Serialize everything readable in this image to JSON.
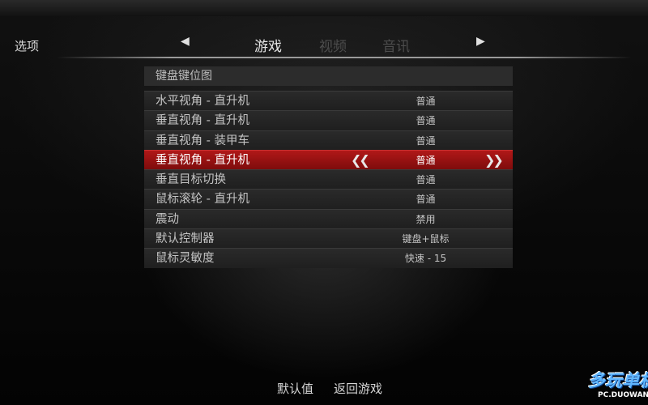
{
  "header": {
    "options_label": "选项",
    "tabs": [
      {
        "label": "游戏",
        "active": true
      },
      {
        "label": "视频",
        "active": false
      },
      {
        "label": "音讯",
        "active": false
      }
    ],
    "prev_arrow_icon": "triangle-left-icon",
    "next_arrow_icon": "triangle-right-icon"
  },
  "panel": {
    "header": "键盘键位图",
    "rows": [
      {
        "label": "水平视角 - 直升机",
        "value": "普通"
      },
      {
        "label": "垂直视角 - 直升机",
        "value": "普通"
      },
      {
        "label": "垂直视角 - 装甲车",
        "value": "普通"
      },
      {
        "label": "垂直视角 - 直升机",
        "value": "普通",
        "selected": true
      },
      {
        "label": "垂直目标切换",
        "value": "普通"
      },
      {
        "label": "鼠标滚轮 - 直升机",
        "value": "普通"
      },
      {
        "label": "震动",
        "value": "禁用"
      },
      {
        "label": "默认控制器",
        "value": "键盘+鼠标"
      },
      {
        "label": "鼠标灵敏度",
        "value": "快速 - 15"
      }
    ],
    "selected_colors": {
      "top": "#b01818",
      "bottom": "#7e0c0c"
    }
  },
  "footer": {
    "default_label": "默认值",
    "return_label": "返回游戏"
  },
  "watermark": {
    "big": "多玩单机",
    "small": "PC.DUOWAN"
  }
}
